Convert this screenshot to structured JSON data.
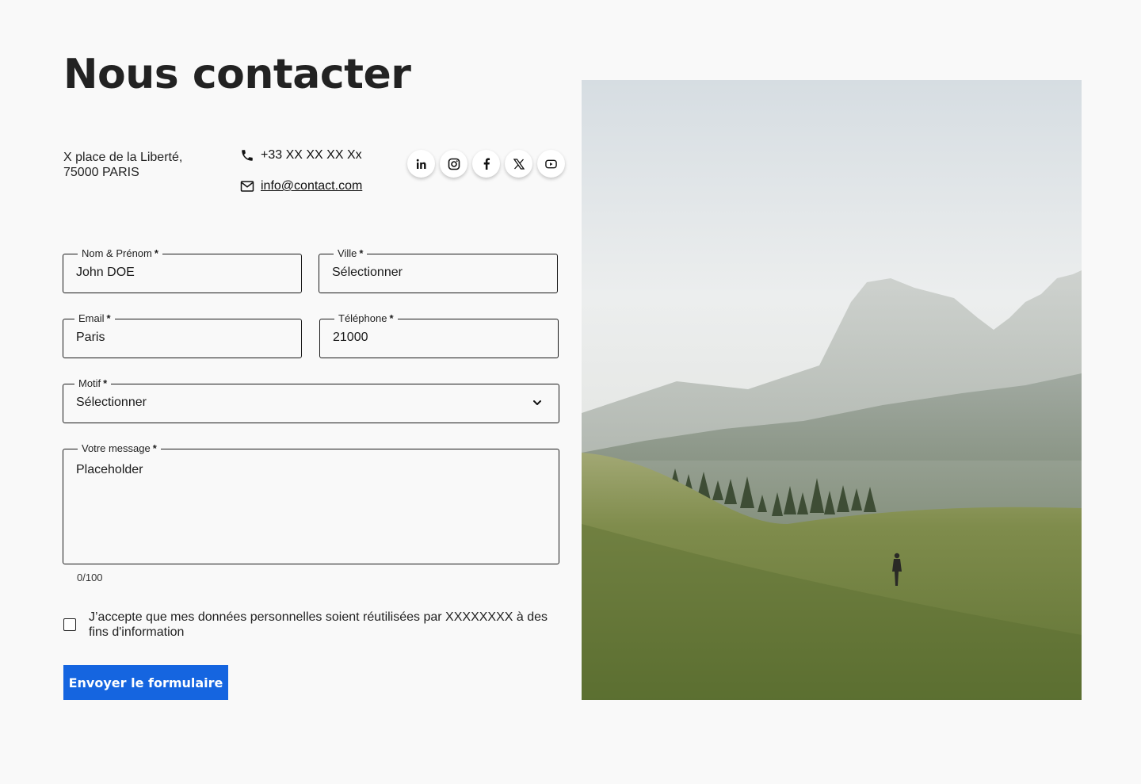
{
  "page": {
    "title": "Nous contacter"
  },
  "contact": {
    "address_line1": "X place de la Liberté,",
    "address_line2": "75000 PARIS",
    "phone": "+33 XX XX XX Xx",
    "email": "info@contact.com"
  },
  "socials": [
    {
      "label": "in",
      "icon": "linkedin-icon"
    },
    {
      "label": "instagram",
      "icon": "instagram-icon"
    },
    {
      "label": "f",
      "icon": "facebook-icon"
    },
    {
      "label": "X",
      "icon": "x-icon"
    },
    {
      "label": "youtube",
      "icon": "youtube-icon"
    }
  ],
  "form": {
    "name": {
      "label": "Nom & Prénom",
      "required": "*",
      "value": "John DOE"
    },
    "city": {
      "label": "Ville",
      "required": "*",
      "value": "Sélectionner"
    },
    "email": {
      "label": "Email",
      "required": "*",
      "value": "Paris"
    },
    "phone": {
      "label": "Téléphone",
      "required": "*",
      "value": "21000"
    },
    "reason": {
      "label": "Motif",
      "required": "*",
      "value": "Sélectionner"
    },
    "message": {
      "label": "Votre message",
      "required": "*",
      "placeholder": "Placeholder",
      "counter": "0/100"
    },
    "consent": "J’accepte que mes données personnelles soient réutilisées par XXXXXXXX à des fins d'information",
    "submit": "Envoyer le formulaire"
  },
  "colors": {
    "accent": "#1565e0",
    "background": "#f9f9f9",
    "border": "#1a1a1a"
  }
}
